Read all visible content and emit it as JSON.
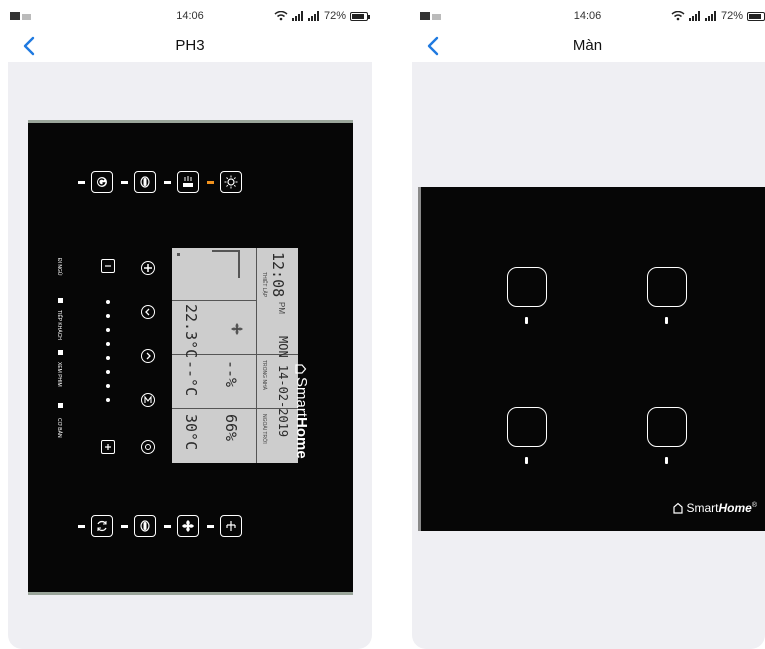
{
  "left_screen": {
    "status": {
      "time": "14:06",
      "battery": "72%",
      "battery_level": 0.72
    },
    "title": "PH3",
    "panel": {
      "top_buttons": [
        "power-icon",
        "swing-icon",
        "mode-icon",
        "light-icon"
      ],
      "bottom_buttons": [
        "refresh-icon",
        "swing-icon",
        "fan-icon",
        "vent-icon"
      ],
      "mode_labels": [
        "ĐI NGỦ",
        "TIẾP KHÁCH",
        "XEM PHIM",
        "CƠ BẢN"
      ],
      "column_buttons": [
        "minus-icon",
        "plus-icon"
      ],
      "round_buttons": [
        "fan-plus-icon",
        "chevron-left-icon",
        "chevron-right-icon",
        "m-icon",
        "auto-icon"
      ],
      "lcd": {
        "time": "12:08",
        "ampm": "PM",
        "setup_label": "THIẾT LẬP",
        "set_temp": "22.3°C",
        "date": "MON 14-02-2019",
        "indoor_label": "TRONG NHÀ",
        "indoor_temp": "--°C",
        "indoor_humidity": "--%",
        "outdoor_label": "NGOÀI TRỜI",
        "outdoor_temp": "30°C",
        "outdoor_humidity": "66%"
      },
      "brand_light": "Smart",
      "brand_bold": "Home"
    }
  },
  "right_screen": {
    "status": {
      "time": "14:06",
      "battery": "72%",
      "battery_level": 0.72
    },
    "title": "Màn",
    "panel": {
      "switch_count": 4,
      "brand_light": "Smart",
      "brand_bold": "Home",
      "brand_mark": "®"
    }
  }
}
